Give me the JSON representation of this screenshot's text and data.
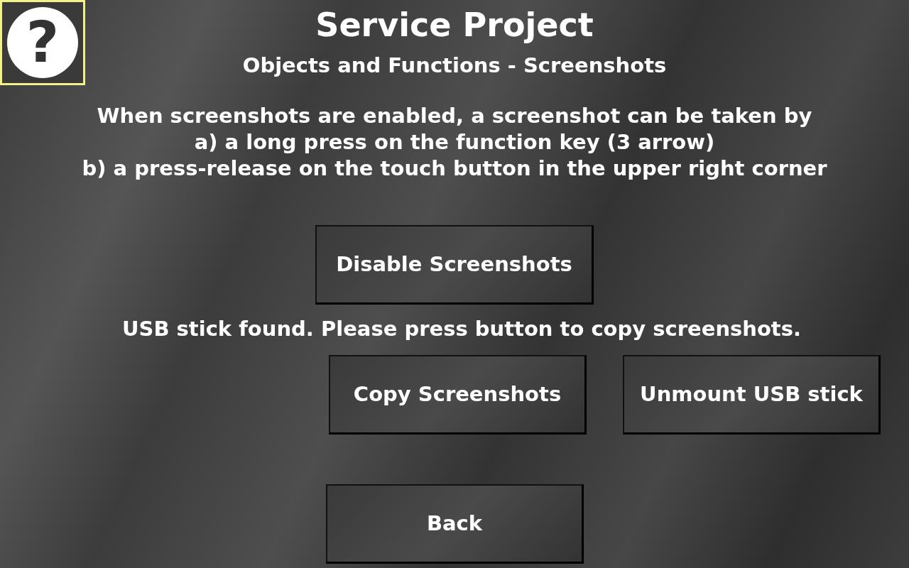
{
  "help_button": {
    "label": "?"
  },
  "title": "Service Project",
  "subtitle": "Objects and Functions - Screenshots",
  "instructions": [
    "When screenshots are enabled, a screenshot can be taken by",
    "a) a long press on the function key (3 arrow)",
    "b) a press-release on the touch button in the upper right corner"
  ],
  "toggle_button": {
    "label": "Disable Screenshots"
  },
  "usb_status": "USB stick found. Please press button to copy screenshots.",
  "usb_buttons": [
    {
      "label": "Copy Screenshots"
    },
    {
      "label": "Unmount USB stick"
    }
  ],
  "back_button": {
    "label": "Back"
  }
}
